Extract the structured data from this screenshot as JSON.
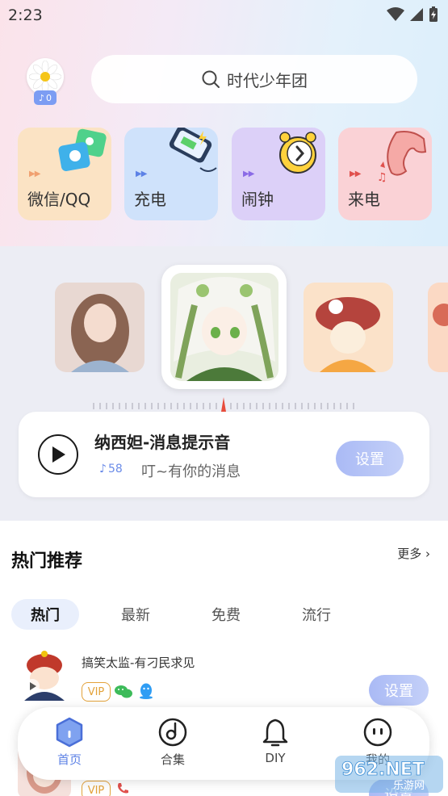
{
  "status_bar": {
    "time": "2:23"
  },
  "profile": {
    "badge_count": "0"
  },
  "search": {
    "placeholder": "时代少年团"
  },
  "categories": [
    {
      "label": "微信/QQ",
      "color": "#fbe3c4"
    },
    {
      "label": "充电",
      "color": "#cfe2fb"
    },
    {
      "label": "闹钟",
      "color": "#dcd0f8"
    },
    {
      "label": "来电",
      "color": "#fad2d6"
    }
  ],
  "now_playing": {
    "title": "纳西妲-消息提示音",
    "play_count": "58",
    "description": "叮~有你的消息",
    "set_label": "设置"
  },
  "hot": {
    "title": "热门推荐",
    "more_label": "更多",
    "tabs": [
      "热门",
      "最新",
      "免费",
      "流行"
    ],
    "active_tab": "热门",
    "items": [
      {
        "title": "搞笑太监-有刁民求见",
        "vip_label": "VIP",
        "set_label": "设置"
      },
      {
        "title": "",
        "vip_label": "VIP",
        "set_label": "设置"
      }
    ]
  },
  "nav": {
    "items": [
      {
        "label": "首页",
        "icon": "home-icon"
      },
      {
        "label": "合集",
        "icon": "disc-icon"
      },
      {
        "label": "DIY",
        "icon": "bell-icon"
      },
      {
        "label": "我的",
        "icon": "smiley-icon"
      }
    ],
    "active": "首页"
  },
  "watermark": {
    "brand": "962.NET",
    "sub": "乐游网"
  },
  "colors": {
    "accent": "#5d82e6",
    "vip": "#e3a23a",
    "button": "#b4c3f6"
  }
}
